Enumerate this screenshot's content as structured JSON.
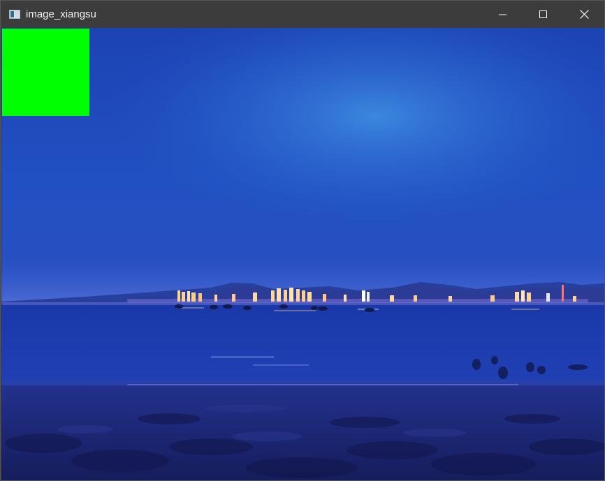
{
  "window": {
    "title": "image_xiangsu",
    "icons": {
      "app": "app-window-icon",
      "minimize": "minimize-icon",
      "maximize": "maximize-icon",
      "close": "close-icon"
    }
  },
  "image": {
    "description_colors": {
      "sky_top": "#1f45b8",
      "sky_glow": "#3a82dd",
      "sea": "#1d3cb0",
      "sand": "#1a2370",
      "marker": "#00ff00"
    }
  }
}
